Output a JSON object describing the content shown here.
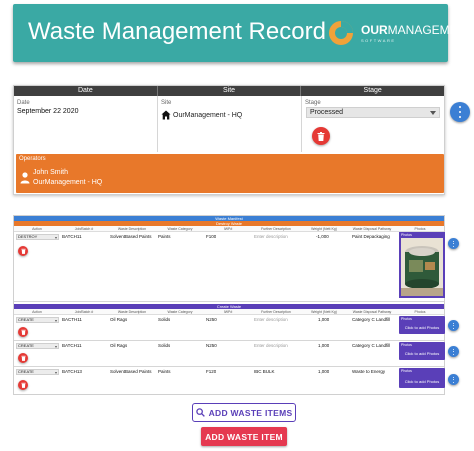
{
  "header": {
    "title": "Waste Management Record",
    "logo_strong": "OUR",
    "logo_light": "MANAGEMENT",
    "logo_sub": "SOFTWARE"
  },
  "record": {
    "columns": [
      "Date",
      "Site",
      "Stage"
    ],
    "date": {
      "label": "Date",
      "value": "September 22 2020"
    },
    "site": {
      "label": "Site",
      "value": "OurManagement - HQ"
    },
    "stage": {
      "label": "Stage",
      "value": "Processed"
    },
    "operators": {
      "label": "Operators",
      "name": "John Smith",
      "org": "OurManagement - HQ"
    }
  },
  "waste_table": {
    "title_band": "Waste Manifest",
    "destroy_band": "Destroy Waste",
    "create_band": "Create Waste",
    "columns": [
      "Action",
      "Job/Batch #",
      "Waste Description",
      "Waste Category",
      "IWP#",
      "Further Description",
      "Weight (Nett Kg)",
      "Waste Disposal Pathway",
      "Photos"
    ],
    "destroy_rows": [
      {
        "action": "DESTROY",
        "batch": "BATCH11",
        "description": "SolventBased Paints",
        "category": "Paints",
        "iwp": "F100",
        "further": "Enter description",
        "weight": "-1,000",
        "pathway": "Paint Depackaging",
        "photos_label": "Photos"
      }
    ],
    "create_rows": [
      {
        "action": "CREATE",
        "batch": "BACTH11",
        "description": "Oil Rags",
        "category": "Solids",
        "iwp": "N250",
        "further": "Enter description",
        "weight": "1,000",
        "pathway": "Category C Landfill",
        "photos_label": "Photos",
        "photos_button": "Click to add Photos"
      },
      {
        "action": "CREATE",
        "batch": "BATCH11",
        "description": "Oil Rags",
        "category": "Solids",
        "iwp": "N250",
        "further": "Enter description",
        "weight": "1,000",
        "pathway": "Category C Landfill",
        "photos_label": "Photos",
        "photos_button": "Click to add Photos"
      },
      {
        "action": "CREATE",
        "batch": "BATCH13",
        "description": "SolventBased Paints",
        "category": "Paints",
        "iwp": "F120",
        "further": "IBC BULK",
        "weight": "1,000",
        "pathway": "Waste to Energy",
        "photos_label": "Photos",
        "photos_button": "Click to add Photos"
      }
    ]
  },
  "actions": {
    "add_items": "ADD WASTE ITEMS",
    "add_item": "ADD WASTE ITEM"
  },
  "colors": {
    "header_bg": "#3aa9a4",
    "operators_bg": "#e8782a",
    "accent_purple": "#5a3fb8",
    "danger": "#e53935",
    "fab_blue": "#3b7fd4"
  }
}
